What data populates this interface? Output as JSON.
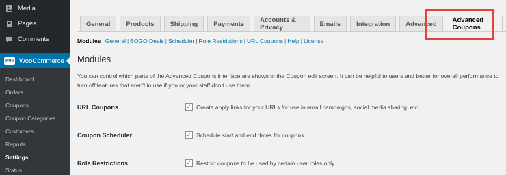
{
  "sidebar": {
    "menu": [
      {
        "label": "Media",
        "icon": "media-icon"
      },
      {
        "label": "Pages",
        "icon": "pages-icon"
      },
      {
        "label": "Comments",
        "icon": "comments-icon"
      }
    ],
    "woocommerce": {
      "label": "WooCommerce",
      "logo_text": "woo"
    },
    "submenu": [
      "Dashboard",
      "Orders",
      "Coupons",
      "Coupon Categories",
      "Customers",
      "Reports",
      "Settings",
      "Status"
    ]
  },
  "tabs": [
    "General",
    "Products",
    "Shipping",
    "Payments",
    "Accounts & Privacy",
    "Emails",
    "Integration",
    "Advanced",
    "Advanced Coupons"
  ],
  "subnav": [
    "Modules",
    "General",
    "BOGO Deals",
    "Scheduler",
    "Role Restrictions",
    "URL Coupons",
    "Help",
    "License"
  ],
  "section": {
    "title": "Modules",
    "description": "You can control which parts of the Advanced Coupons interface are shown in the Coupon edit screen. It can be helpful to users and better for overall performance to turn off features that aren't in use if you or your staff don't use them."
  },
  "settings": [
    {
      "label": "URL Coupons",
      "text": "Create apply links for your URLs for use in email campaigns, social media sharing, etc.",
      "checked": true
    },
    {
      "label": "Coupon Scheduler",
      "text": "Schedule start and end dates for coupons.",
      "checked": true
    },
    {
      "label": "Role Restrictions",
      "text": "Restrict coupons to be used by certain user roles only.",
      "checked": true
    }
  ],
  "colors": {
    "accent": "#0073aa",
    "sidebar": "#23282d",
    "highlight": "#e8403c"
  }
}
